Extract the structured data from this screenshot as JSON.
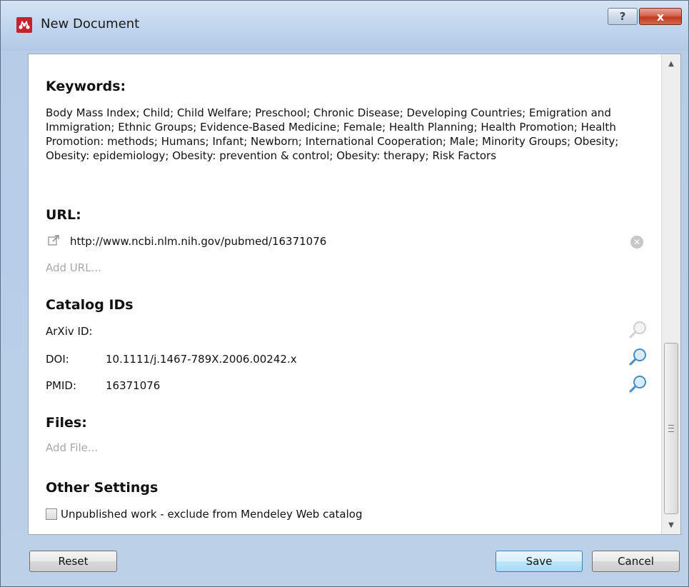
{
  "window": {
    "title": "New Document",
    "help_label": "?",
    "close_label": "x"
  },
  "keywords": {
    "heading": "Keywords:",
    "text": "Body Mass Index; Child; Child Welfare; Preschool; Chronic Disease; Developing Countries; Emigration and Immigration; Ethnic Groups; Evidence-Based Medicine; Female; Health Planning; Health Promotion; Health Promotion: methods; Humans; Infant; Newborn; International Cooperation; Male; Minority Groups; Obesity; Obesity: epidemiology; Obesity: prevention & control; Obesity: therapy; Risk Factors"
  },
  "url": {
    "heading": "URL:",
    "value": "http://www.ncbi.nlm.nih.gov/pubmed/16371076",
    "add_label": "Add URL..."
  },
  "catalog": {
    "heading": "Catalog IDs",
    "rows": [
      {
        "label": "ArXiv ID:",
        "value": ""
      },
      {
        "label": "DOI:",
        "value": "10.1111/j.1467-789X.2006.00242.x"
      },
      {
        "label": "PMID:",
        "value": "16371076"
      }
    ]
  },
  "files": {
    "heading": "Files:",
    "add_label": "Add File..."
  },
  "other": {
    "heading": "Other Settings",
    "unpublished_label": "Unpublished work - exclude from Mendeley Web catalog",
    "unpublished_checked": false
  },
  "buttons": {
    "reset": "Reset",
    "save": "Save",
    "cancel": "Cancel"
  },
  "colors": {
    "app_icon": "#c4232b",
    "save_border": "#3c7fb1"
  }
}
